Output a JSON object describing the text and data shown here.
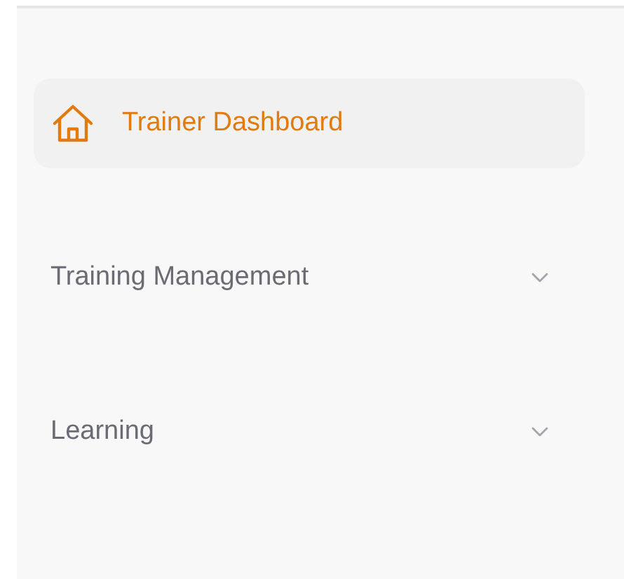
{
  "sidebar": {
    "items": [
      {
        "kind": "link",
        "label": "Trainer Dashboard",
        "selected": true
      },
      {
        "kind": "group",
        "label": "Training Management",
        "selected": false,
        "expanded": false
      },
      {
        "kind": "group",
        "label": "Learning",
        "selected": false,
        "expanded": false
      }
    ]
  }
}
